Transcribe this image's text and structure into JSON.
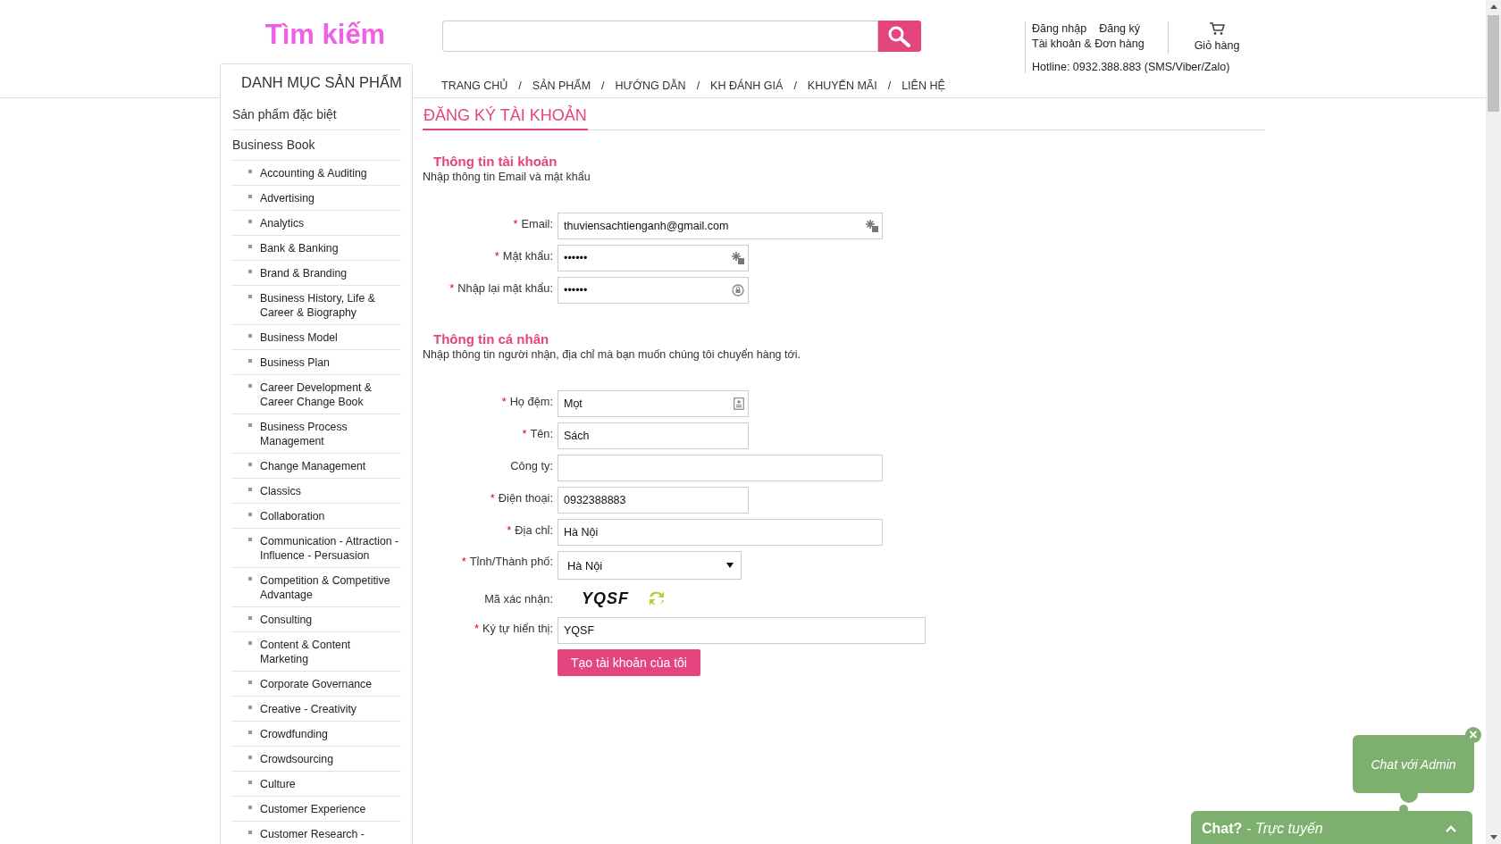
{
  "header": {
    "logo": "Tìm kiếm",
    "account_links": [
      "Đăng nhập",
      "Đăng ký"
    ],
    "orders_link": "Tài khoản & Đơn hàng",
    "cart": "Giỏ hàng",
    "hotline": "Hotline: 0932.388.883 (SMS/Viber/Zalo)"
  },
  "nav": {
    "separator": "/",
    "items": [
      "TRANG CHỦ",
      "SẢN PHẨM",
      "HƯỚNG DẪN",
      "KH ĐÁNH GIÁ",
      "KHUYẾN MÃI",
      "LIÊN HỆ"
    ]
  },
  "sidebar": {
    "title": "DANH MỤC SẢN PHẨM",
    "items": [
      {
        "label": "Sản phẩm đặc biệt"
      },
      {
        "label": "Business Book",
        "children": [
          {
            "label": "Accounting & Auditing"
          },
          {
            "label": "Advertising"
          },
          {
            "label": "Analytics"
          },
          {
            "label": "Bank & Banking"
          },
          {
            "label": "Brand & Branding"
          },
          {
            "label": "Business History, Life & Career & Biography"
          },
          {
            "label": "Business Model"
          },
          {
            "label": "Business Plan"
          },
          {
            "label": "Career Development & Career Change Book"
          },
          {
            "label": "Business Process Management"
          },
          {
            "label": "Change Management"
          },
          {
            "label": "Classics"
          },
          {
            "label": "Collaboration"
          },
          {
            "label": "Communication - Attraction - Influence - Persuasion"
          },
          {
            "label": "Competition & Competitive Advantage"
          },
          {
            "label": "Consulting"
          },
          {
            "label": "Content & Content Marketing"
          },
          {
            "label": "Corporate Governance"
          },
          {
            "label": "Creative - Creativity"
          },
          {
            "label": "Crowdfunding"
          },
          {
            "label": "Crowdsourcing"
          },
          {
            "label": "Culture"
          },
          {
            "label": "Customer Experience"
          },
          {
            "label": "Customer Research -"
          }
        ]
      }
    ]
  },
  "page_title": "ĐĂNG KÝ TÀI KHOẢN",
  "required_marker": "*",
  "sections": [
    {
      "title": "Thông tin tài khoản",
      "description": "Nhập thông tin Email và mật khẩu",
      "fields": [
        {
          "label": "Email:",
          "required": true,
          "kind": "email",
          "value": "thuviensachtienganh@gmail.com"
        },
        {
          "label": "Mật khẩu:",
          "required": true,
          "kind": "password",
          "value": "••••••"
        },
        {
          "label": "Nhập lại mật khẩu:",
          "required": true,
          "kind": "confirm",
          "value": "••••••"
        }
      ]
    },
    {
      "title": "Thông tin cá nhân",
      "description": "Nhập thông tin người nhận, địa chỉ mà bạn muốn chúng tôi chuyển hàng tới.",
      "fields": [
        {
          "label": "Họ đệm:",
          "required": true,
          "kind": "name",
          "value": "Mọt"
        },
        {
          "label": "Tên:",
          "required": true,
          "kind": "short",
          "value": "Sách"
        },
        {
          "label": "Công ty:",
          "required": false,
          "kind": "long"
        },
        {
          "label": "Điện thoại:",
          "required": true,
          "kind": "short",
          "value": "0932388883"
        },
        {
          "label": "Địa chỉ:",
          "required": true,
          "kind": "long",
          "value": "Hà Nội"
        },
        {
          "label": "Tỉnh/Thành phố:",
          "required": true,
          "kind": "select",
          "value": "Hà Nội"
        },
        {
          "label": "Mã xác nhận:",
          "required": false,
          "kind": "captcha",
          "value": "YQSF"
        },
        {
          "label": "Ký tự hiển thị:",
          "required": true,
          "kind": "code",
          "value": "YQSF"
        }
      ]
    }
  ],
  "submit": "Tạo tài khoản của tôi",
  "chat": {
    "bubble": "Chat với Admin",
    "close": "×",
    "bar_title": "Chat?",
    "bar_status": "- Trực tuyến"
  }
}
